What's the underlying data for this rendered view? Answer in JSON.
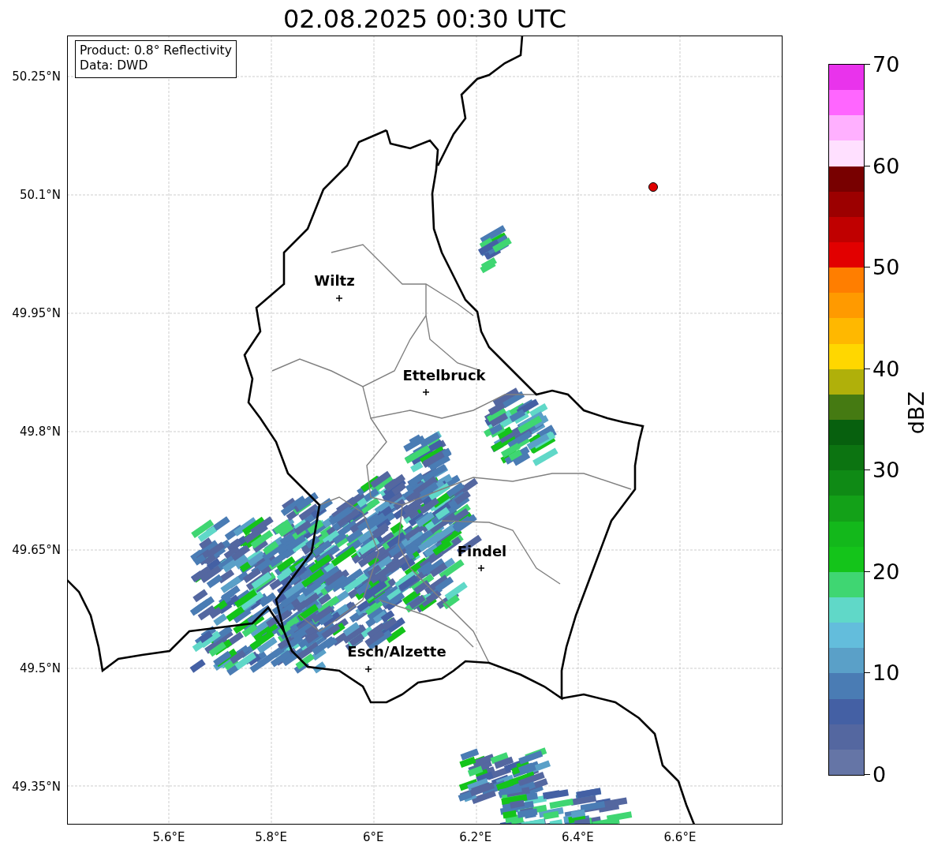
{
  "title": "02.08.2025 00:30 UTC",
  "info_box": [
    "Product: 0.8° Reflectivity",
    "Data: DWD"
  ],
  "lat_labels": [
    "50.25°N",
    "50.1°N",
    "49.95°N",
    "49.8°N",
    "49.65°N",
    "49.5°N",
    "49.35°N"
  ],
  "lon_labels": [
    "5.6°E",
    "5.8°E",
    "6°E",
    "6.2°E",
    "6.4°E",
    "6.6°E"
  ],
  "cities": [
    {
      "name": "Wiltz"
    },
    {
      "name": "Ettelbruck"
    },
    {
      "name": "Findel"
    },
    {
      "name": "Esch/Alzette"
    }
  ],
  "colorbar": {
    "label": "dBZ",
    "ticks": [
      "70",
      "60",
      "50",
      "40",
      "30",
      "20",
      "10",
      "0"
    ],
    "bands": [
      {
        "color": "#e933ec"
      },
      {
        "color": "#ff66ff"
      },
      {
        "color": "#ffb0ff"
      },
      {
        "color": "#ffe0ff"
      },
      {
        "color": "#780000"
      },
      {
        "color": "#9c0000"
      },
      {
        "color": "#c00000"
      },
      {
        "color": "#e20000"
      },
      {
        "color": "#ff7e00"
      },
      {
        "color": "#ff9a00"
      },
      {
        "color": "#ffb800"
      },
      {
        "color": "#ffd700"
      },
      {
        "color": "#b0b00a"
      },
      {
        "color": "#457a12"
      },
      {
        "color": "#07600e"
      },
      {
        "color": "#0c7411"
      },
      {
        "color": "#0f8a15"
      },
      {
        "color": "#13a118"
      },
      {
        "color": "#13b81b"
      },
      {
        "color": "#14c41a"
      },
      {
        "color": "#3fd672"
      },
      {
        "color": "#60d8c8"
      },
      {
        "color": "#63bddc"
      },
      {
        "color": "#5aa0c8"
      },
      {
        "color": "#4a7cb4"
      },
      {
        "color": "#4460a4"
      },
      {
        "color": "#5467a0"
      },
      {
        "color": "#6575a6"
      }
    ]
  }
}
